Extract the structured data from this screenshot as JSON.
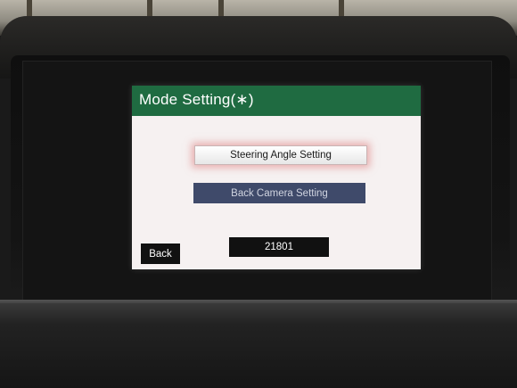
{
  "screen": {
    "title": "Mode Setting(∗)",
    "buttons": {
      "steering_angle": "Steering Angle Setting",
      "back_camera": "Back Camera Setting",
      "back": "Back"
    },
    "code": "21801"
  },
  "colors": {
    "title_bar": "#1f6b41",
    "selected_glow": "#dc7878",
    "camera_button": "#3f4a6a"
  }
}
